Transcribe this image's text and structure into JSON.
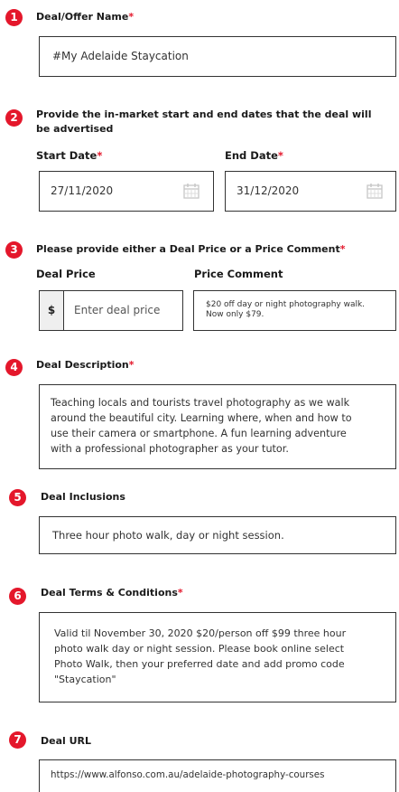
{
  "sections": [
    {
      "number": "1",
      "title": "Deal/Offer Name",
      "required": "*"
    },
    {
      "number": "2",
      "title_line1": "Provide the in-market start and end dates that the deal will",
      "title_line2": "be advertised"
    },
    {
      "number": "3",
      "title": "Please provide either a Deal Price or a Price Comment",
      "required": "*"
    },
    {
      "number": "4",
      "title": "Deal Description",
      "required": "*"
    },
    {
      "number": "5",
      "title": "Deal Inclusions"
    },
    {
      "number": "6",
      "title": "Deal Terms & Conditions",
      "required": "*"
    },
    {
      "number": "7",
      "title": "Deal URL"
    }
  ],
  "deal_name": {
    "value": "#My Adelaide Staycation"
  },
  "dates": {
    "start_label": "Start Date",
    "start_required": "*",
    "start_value": "27/11/2020",
    "end_label": "End Date",
    "end_required": "*",
    "end_value": "31/12/2020",
    "calendar_icon": "calendar-icon"
  },
  "price": {
    "price_label": "Deal Price",
    "currency": "$",
    "price_placeholder": "Enter deal price",
    "comment_label": "Price Comment",
    "comment_line1": "$20 off day or night photography walk.",
    "comment_line2": "Now only $79."
  },
  "description": {
    "lines": [
      "Teaching locals and tourists travel photography as we walk",
      "around the beautiful city. Learning where, when and how to",
      "use their camera or smartphone. A fun learning adventure",
      "with a professional photographer as your tutor."
    ]
  },
  "inclusions": {
    "value": "Three hour photo walk, day or night session."
  },
  "terms": {
    "lines": [
      "Valid til November 30, 2020 $20/person off $99 three hour",
      "photo walk day or night session. Please book online select",
      "Photo Walk, then your preferred date and add promo code",
      "\"Staycation\""
    ]
  },
  "url": {
    "value": "https://www.alfonso.com.au/adelaide-photography-courses"
  },
  "colors": {
    "accent": "#e4172b",
    "border": "#333333",
    "currency_bg": "#efefef"
  }
}
